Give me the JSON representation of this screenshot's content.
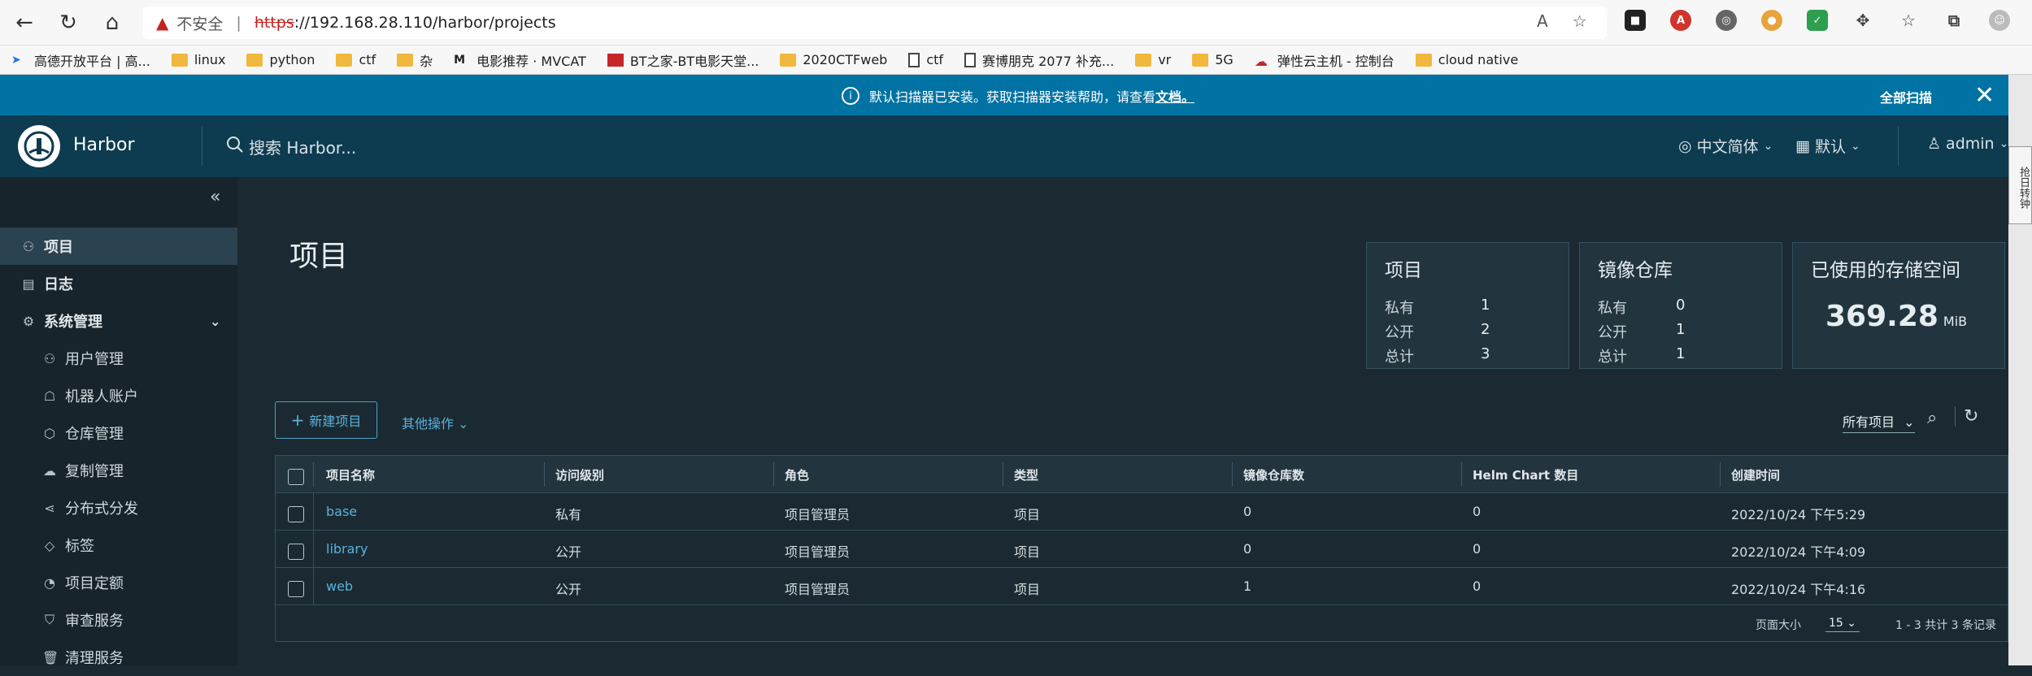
{
  "browser": {
    "insecure_label": "不安全",
    "url_scheme": "https",
    "url_rest": "://192.168.28.110/harbor/projects",
    "bookmarks": [
      "高德开放平台 | 高...",
      "linux",
      "python",
      "ctf",
      "杂",
      "电影推荐 · MVCAT",
      "BT之家-BT电影天堂...",
      "2020CTFweb",
      "ctf",
      "赛博朋克 2077 补充...",
      "vr",
      "5G",
      "弹性云主机 - 控制台",
      "cloud native"
    ]
  },
  "banner": {
    "message": "默认扫描器已安装。获取扫描器安装帮助，请查看",
    "doc_link": "文档。",
    "scan_all": "全部扫描",
    "close": "✕"
  },
  "header": {
    "brand": "Harbor",
    "search_placeholder": "搜索 Harbor...",
    "language": "中文简体",
    "datetime_format": "默认",
    "user": "admin"
  },
  "side_strip_text": "抢日转钟",
  "sidebar": {
    "items": [
      {
        "label": "项目",
        "icon": "projects-icon"
      },
      {
        "label": "日志",
        "icon": "logs-icon"
      },
      {
        "label": "系统管理",
        "icon": "admin-icon"
      },
      {
        "label": "用户管理",
        "icon": "users-icon"
      },
      {
        "label": "机器人账户",
        "icon": "robot-icon"
      },
      {
        "label": "仓库管理",
        "icon": "registry-icon"
      },
      {
        "label": "复制管理",
        "icon": "replication-icon"
      },
      {
        "label": "分布式分发",
        "icon": "distribution-icon"
      },
      {
        "label": "标签",
        "icon": "tag-icon"
      },
      {
        "label": "项目定额",
        "icon": "quota-icon"
      },
      {
        "label": "审查服务",
        "icon": "shield-icon"
      },
      {
        "label": "清理服务",
        "icon": "trash-icon"
      }
    ]
  },
  "main": {
    "title": "项目",
    "cards": {
      "projects": {
        "title": "项目",
        "private_label": "私有",
        "private": "1",
        "public_label": "公开",
        "public": "2",
        "total_label": "总计",
        "total": "3"
      },
      "repositories": {
        "title": "镜像仓库",
        "private_label": "私有",
        "private": "0",
        "public_label": "公开",
        "public": "1",
        "total_label": "总计",
        "total": "1"
      },
      "storage": {
        "title": "已使用的存储空间",
        "value": "369.28",
        "unit": "MiB"
      }
    },
    "new_project": "新建项目",
    "other_ops": "其他操作",
    "filter": "所有项目",
    "table": {
      "headers": [
        "项目名称",
        "访问级别",
        "角色",
        "类型",
        "镜像仓库数",
        "Helm Chart 数目",
        "创建时间"
      ],
      "rows": [
        [
          "base",
          "私有",
          "项目管理员",
          "项目",
          "0",
          "0",
          "2022/10/24 下午5:29"
        ],
        [
          "library",
          "公开",
          "项目管理员",
          "项目",
          "0",
          "0",
          "2022/10/24 下午4:09"
        ],
        [
          "web",
          "公开",
          "项目管理员",
          "项目",
          "1",
          "0",
          "2022/10/24 下午4:16"
        ]
      ],
      "page_size_label": "页面大小",
      "page_size": "15",
      "total_text": "1 - 3 共计 3 条记录"
    }
  },
  "colors": {
    "banner": "#0072a3",
    "header": "#0d3b4f",
    "sidebar": "#17242b",
    "content": "#1b2a32",
    "link": "#58b2da"
  }
}
